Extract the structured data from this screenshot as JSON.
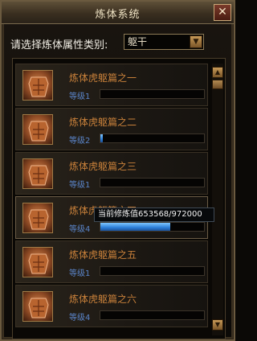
{
  "window": {
    "title": "炼体系统",
    "close_icon": "close-icon"
  },
  "filter": {
    "label": "请选择炼体属性类别:",
    "selected": "躯干"
  },
  "items": [
    {
      "name": "炼体虎躯篇之一",
      "level": "等级1",
      "progress": 0.0
    },
    {
      "name": "炼体虎躯篇之二",
      "level": "等级2",
      "progress": 0.02
    },
    {
      "name": "炼体虎躯篇之三",
      "level": "等级1",
      "progress": 0.0
    },
    {
      "name": "炼体虎躯篇之四",
      "level": "等级4",
      "progress": 0.672
    },
    {
      "name": "炼体虎躯篇之五",
      "level": "等级1",
      "progress": 0.0
    },
    {
      "name": "炼体虎躯篇之六",
      "level": "等级4",
      "progress": 0.0
    }
  ],
  "tooltip": {
    "text": "当前修炼值653568/972000"
  },
  "colors": {
    "item_name": "#c8803a",
    "item_level": "#5a84c8",
    "progress_fill": "#2b7ed8"
  }
}
